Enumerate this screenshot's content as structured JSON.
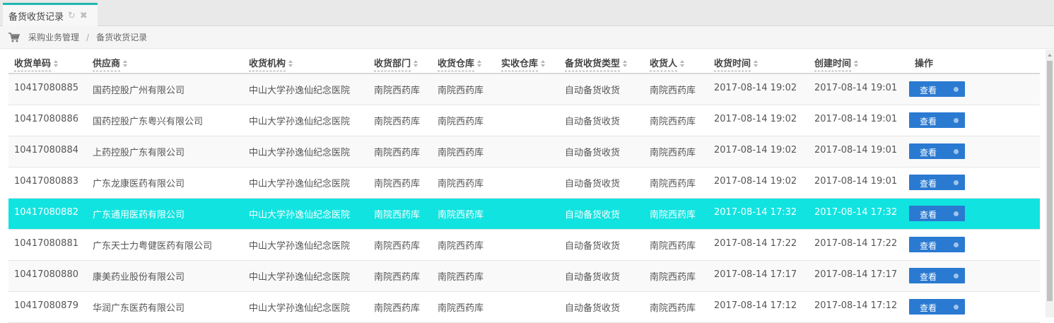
{
  "tab": {
    "label": "备货收货记录"
  },
  "breadcrumb": {
    "items": [
      "采购业务管理",
      "备货收货记录"
    ]
  },
  "table": {
    "columns": [
      "收货单码",
      "供应商",
      "收货机构",
      "收货部门",
      "收货仓库",
      "实收仓库",
      "备货收货类型",
      "收货人",
      "收货时间",
      "创建时间",
      "操作"
    ],
    "action_label": "查看",
    "rows": [
      [
        "10417080885",
        "国药控股广州有限公司",
        "中山大学孙逸仙纪念医院",
        "南院西药库",
        "南院西药库",
        "",
        "自动备货收货",
        "南院西药库",
        "2017-08-14 19:02",
        "2017-08-14 19:01"
      ],
      [
        "10417080886",
        "国药控股广东粤兴有限公司",
        "中山大学孙逸仙纪念医院",
        "南院西药库",
        "南院西药库",
        "",
        "自动备货收货",
        "南院西药库",
        "2017-08-14 19:02",
        "2017-08-14 19:01"
      ],
      [
        "10417080884",
        "上药控股广东有限公司",
        "中山大学孙逸仙纪念医院",
        "南院西药库",
        "南院西药库",
        "",
        "自动备货收货",
        "南院西药库",
        "2017-08-14 19:02",
        "2017-08-14 19:01"
      ],
      [
        "10417080883",
        "广东龙康医药有限公司",
        "中山大学孙逸仙纪念医院",
        "南院西药库",
        "南院西药库",
        "",
        "自动备货收货",
        "南院西药库",
        "2017-08-14 19:02",
        "2017-08-14 19:01"
      ],
      [
        "10417080882",
        "广东通用医药有限公司",
        "中山大学孙逸仙纪念医院",
        "南院西药库",
        "南院西药库",
        "",
        "自动备货收货",
        "南院西药库",
        "2017-08-14 17:32",
        "2017-08-14 17:32"
      ],
      [
        "10417080881",
        "广东天士力粤健医药有限公司",
        "中山大学孙逸仙纪念医院",
        "南院西药库",
        "南院西药库",
        "",
        "自动备货收货",
        "南院西药库",
        "2017-08-14 17:22",
        "2017-08-14 17:22"
      ],
      [
        "10417080880",
        "康美药业股份有限公司",
        "中山大学孙逸仙纪念医院",
        "南院西药库",
        "南院西药库",
        "",
        "自动备货收货",
        "南院西药库",
        "2017-08-14 17:17",
        "2017-08-14 17:17"
      ],
      [
        "10417080879",
        "华润广东医药有限公司",
        "中山大学孙逸仙纪念医院",
        "南院西药库",
        "南院西药库",
        "",
        "自动备货收货",
        "南院西药库",
        "2017-08-14 17:12",
        "2017-08-14 17:12"
      ]
    ],
    "selected_row": 4
  },
  "colors": {
    "accent": "#1fb6b0",
    "selected_row": "#11e3e0",
    "button": "#2a7ad1"
  },
  "icons": {
    "tab_refresh": "refresh-icon",
    "tab_close": "close-icon",
    "breadcrumb": "cart-icon"
  }
}
